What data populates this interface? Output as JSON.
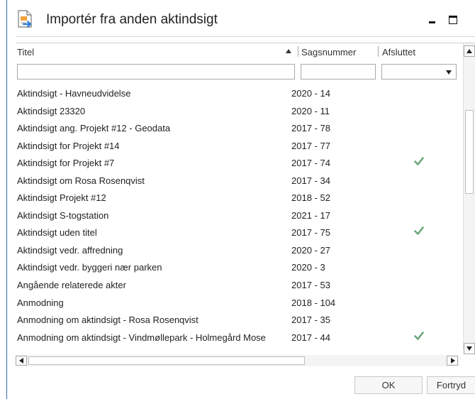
{
  "window": {
    "title": "Importér fra anden aktindsigt",
    "icon": "import-document-icon",
    "minimize_icon": "minimize-icon",
    "maximize_icon": "maximize-icon",
    "close_glyph": "×"
  },
  "grid": {
    "columns": [
      {
        "label": "Titel",
        "sort": "ascending"
      },
      {
        "label": "Sagsnummer"
      },
      {
        "label": "Afsluttet"
      }
    ],
    "filters": {
      "title": "",
      "case_number": "",
      "closed": ""
    },
    "rows": [
      {
        "title": "Aktindsigt - Havneudvidelse",
        "case_number": "2020 - 14",
        "closed": false
      },
      {
        "title": "Aktindsigt 23320",
        "case_number": "2020 - 11",
        "closed": false
      },
      {
        "title": "Aktindsigt ang. Projekt #12 - Geodata",
        "case_number": "2017 - 78",
        "closed": false
      },
      {
        "title": "Aktindsigt for Projekt #14",
        "case_number": "2017 - 77",
        "closed": false
      },
      {
        "title": "Aktindsigt for Projekt #7",
        "case_number": "2017 - 74",
        "closed": true
      },
      {
        "title": "Aktindsigt om Rosa Rosenqvist",
        "case_number": "2017 - 34",
        "closed": false
      },
      {
        "title": "Aktindsigt Projekt #12",
        "case_number": "2018 - 52",
        "closed": false
      },
      {
        "title": "Aktindsigt S-togstation",
        "case_number": "2021 - 17",
        "closed": false
      },
      {
        "title": "Aktindsigt uden titel",
        "case_number": "2017 - 75",
        "closed": true
      },
      {
        "title": "Aktindsigt vedr. affredning",
        "case_number": "2020 - 27",
        "closed": false
      },
      {
        "title": "Aktindsigt vedr. byggeri nær parken",
        "case_number": "2020 - 3",
        "closed": false
      },
      {
        "title": "Angående relaterede akter",
        "case_number": "2017 - 53",
        "closed": false
      },
      {
        "title": "Anmodning",
        "case_number": "2018 - 104",
        "closed": false
      },
      {
        "title": "Anmodning om aktindsigt - Rosa Rosenqvist",
        "case_number": "2017 - 35",
        "closed": false
      },
      {
        "title": "Anmodning om aktindsigt - Vindmøllepark - Holmegård Mose",
        "case_number": "2017 - 44",
        "closed": true
      }
    ]
  },
  "buttons": {
    "ok": "OK",
    "cancel": "Fortryd"
  },
  "colors": {
    "checkmark": "#6aa77a",
    "accent": "#2b6cb0"
  }
}
